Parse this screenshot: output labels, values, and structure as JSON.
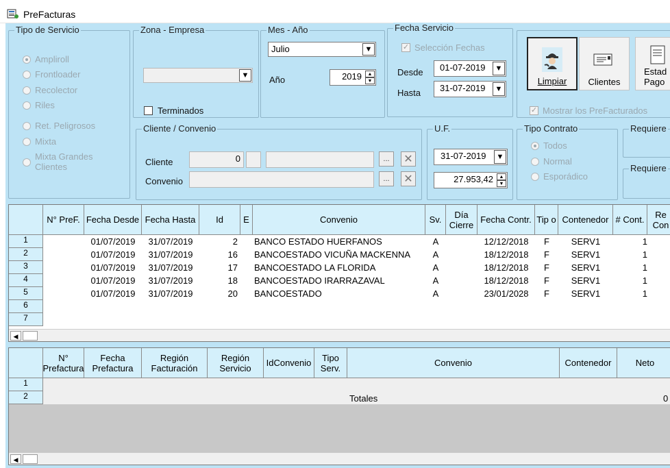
{
  "window": {
    "title": "PreFacturas",
    "icon": "app-icon"
  },
  "tipo_servicio": {
    "title": "Tipo de Servicio",
    "options": [
      "Ampliroll",
      "Frontloader",
      "Recolector",
      "Riles",
      "Ret. Peligrosos",
      "Mixta",
      "Mixta Grandes",
      "Clientes"
    ],
    "selected": "Ampliroll"
  },
  "zona": {
    "title": "Zona - Empresa",
    "value": "",
    "terminados": "Terminados"
  },
  "mes": {
    "title": "Mes - Año",
    "month": "Julio",
    "anio_label": "Año",
    "anio": "2019"
  },
  "fecha": {
    "title": "Fecha Servicio",
    "seleccion": "Selección Fechas",
    "desde_label": "Desde",
    "desde": "01-07-2019",
    "hasta_label": "Hasta",
    "hasta": "31-07-2019"
  },
  "buttons": {
    "limpiar": "Limpiar",
    "clientes": "Clientes",
    "estado": "Estad",
    "pago": "Pago",
    "mostrar": "Mostrar los PreFacturados"
  },
  "cliente": {
    "title": "Cliente / Convenio",
    "cliente_label": "Cliente",
    "cliente_id": "0",
    "convenio_label": "Convenio",
    "dots": "..."
  },
  "uf": {
    "title": "U.F.",
    "fecha": "31-07-2019",
    "valor": "27.953,42"
  },
  "tipo_contrato": {
    "title": "Tipo Contrato",
    "options": [
      "Todos",
      "Normal",
      "Esporádico"
    ]
  },
  "requiere": [
    "Requiere",
    "Requiere"
  ],
  "grid1": {
    "headers": [
      "N° PreF.",
      "Fecha Desde",
      "Fecha Hasta",
      "Id",
      "E",
      "Convenio",
      "Sv.",
      "Día Cierre",
      "Fecha Contr.",
      "Tip o",
      "Contenedor",
      "# Cont.",
      "Re Con"
    ],
    "rows": [
      {
        "n": "1",
        "desde": "01/07/2019",
        "hasta": "31/07/2019",
        "id": "2",
        "conv": "BANCO ESTADO HUERFANOS",
        "sv": "A",
        "fc": "12/12/2018",
        "tip": "F",
        "cont": "SERV1",
        "nc": "1"
      },
      {
        "n": "2",
        "desde": "01/07/2019",
        "hasta": "31/07/2019",
        "id": "16",
        "conv": "BANCOESTADO VICUÑA MACKENNA",
        "sv": "A",
        "fc": "18/12/2018",
        "tip": "F",
        "cont": "SERV1",
        "nc": "1"
      },
      {
        "n": "3",
        "desde": "01/07/2019",
        "hasta": "31/07/2019",
        "id": "17",
        "conv": "BANCOESTADO LA FLORIDA",
        "sv": "A",
        "fc": "18/12/2018",
        "tip": "F",
        "cont": "SERV1",
        "nc": "1"
      },
      {
        "n": "4",
        "desde": "01/07/2019",
        "hasta": "31/07/2019",
        "id": "18",
        "conv": "BANCOESTADO IRARRAZAVAL",
        "sv": "A",
        "fc": "18/12/2018",
        "tip": "F",
        "cont": "SERV1",
        "nc": "1"
      },
      {
        "n": "5",
        "desde": "01/07/2019",
        "hasta": "31/07/2019",
        "id": "20",
        "conv": "BANCOESTADO",
        "sv": "A",
        "fc": "23/01/2028",
        "tip": "F",
        "cont": "SERV1",
        "nc": "1"
      },
      {
        "n": "6"
      },
      {
        "n": "7"
      }
    ]
  },
  "grid2": {
    "headers": [
      "N° Prefactura",
      "Fecha Prefactura",
      "Región Facturación",
      "Región Servicio",
      "IdConvenio",
      "Tipo Serv.",
      "Convenio",
      "Contenedor",
      "Neto"
    ],
    "rows": [
      "1",
      "2"
    ],
    "totales": "Totales",
    "total_neto": "0"
  }
}
